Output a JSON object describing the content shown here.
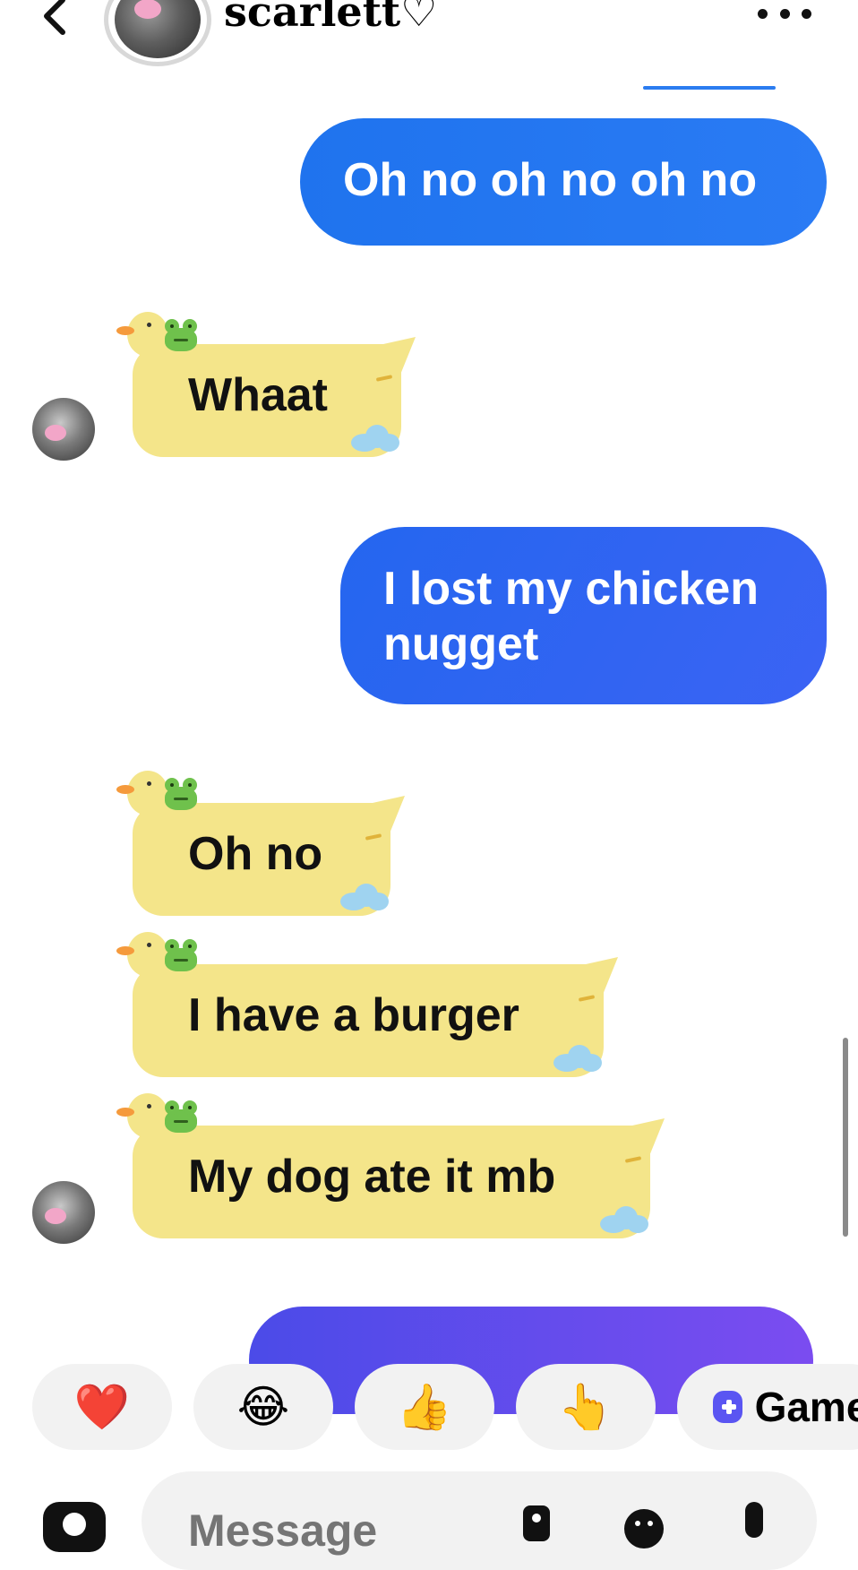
{
  "header": {
    "contact_name": "scarlett♡",
    "back_icon": "chevron-left-icon",
    "more_icon": "more-horizontal-icon"
  },
  "messages": [
    {
      "direction": "sent",
      "text": "Oh no oh no oh no"
    },
    {
      "direction": "received",
      "text": "Whaat"
    },
    {
      "direction": "sent",
      "text": "I lost my chicken nugget"
    },
    {
      "direction": "received",
      "text": "Oh no"
    },
    {
      "direction": "received",
      "text": "I have a burger"
    },
    {
      "direction": "received",
      "text": "My dog ate it mb"
    }
  ],
  "quick_reactions": {
    "heart": "❤️",
    "laugh": "😂",
    "thumbs_up": "👍",
    "pointing": "👆",
    "games_label": "Games"
  },
  "composer": {
    "placeholder": "Message"
  },
  "colors": {
    "sent_bubble": "#1f73ee",
    "received_bubble": "#f4e58a",
    "games_accent": "#5a55f2"
  }
}
